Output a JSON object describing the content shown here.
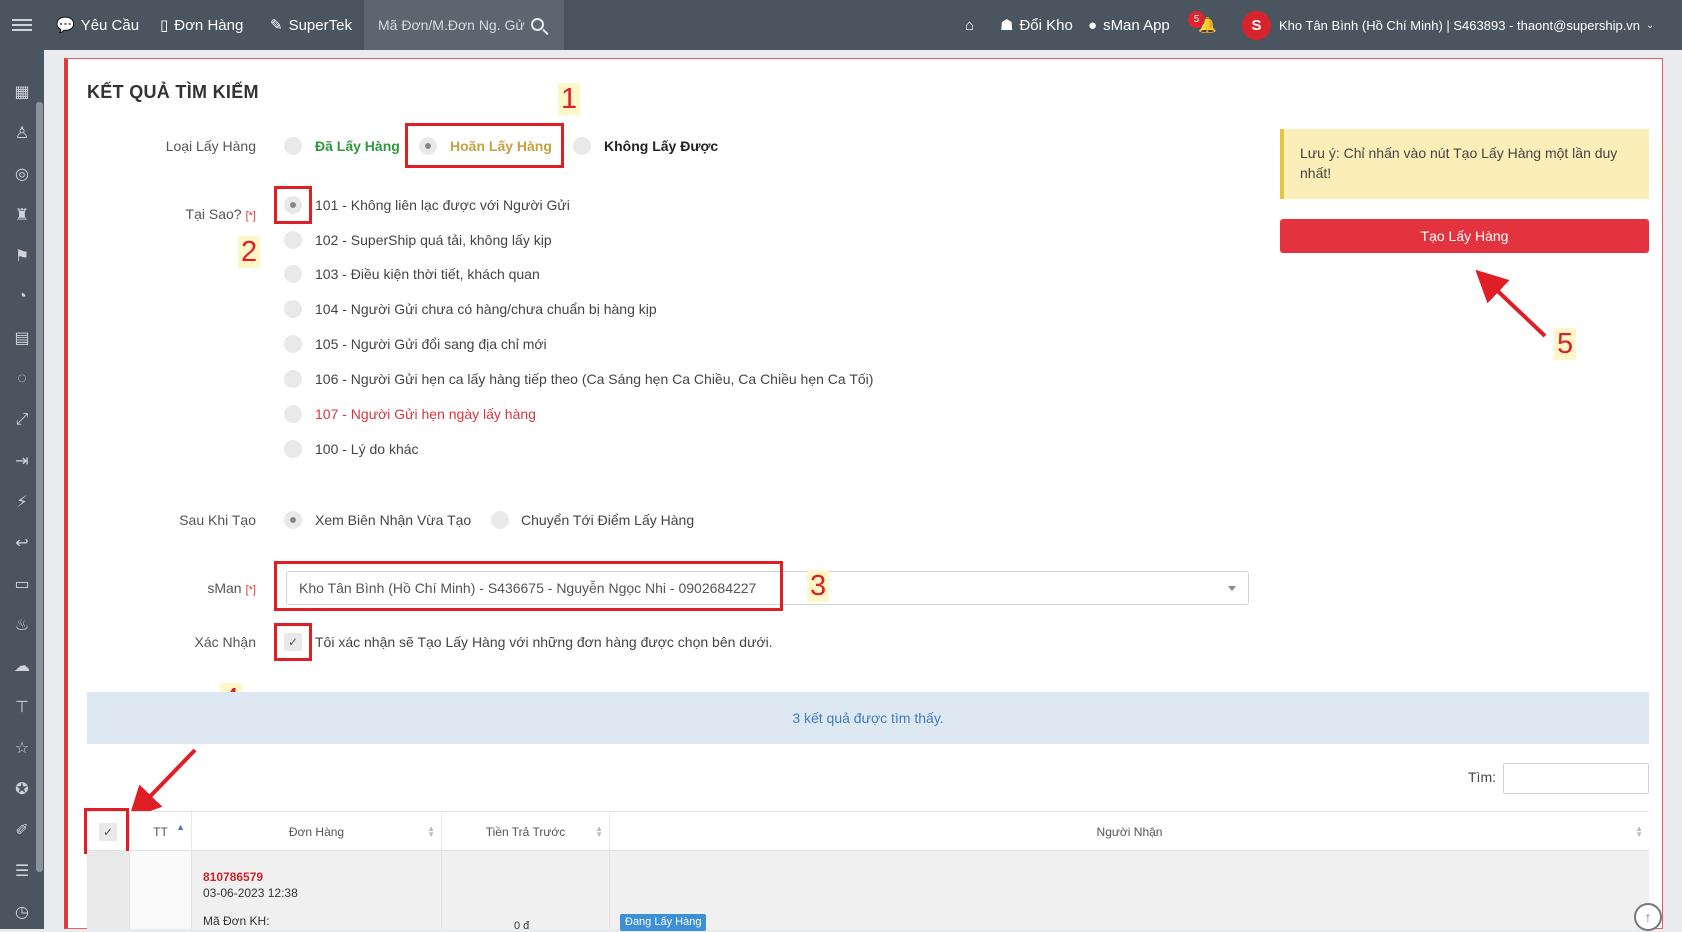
{
  "topbar": {
    "nav": [
      {
        "label": "Yêu Cầu",
        "icon": "chat-icon"
      },
      {
        "label": "Đơn Hàng",
        "icon": "document-icon"
      },
      {
        "label": "SuperTek",
        "icon": "edit-icon"
      }
    ],
    "search_placeholder": "Mã Đơn/M.Đơn Ng. Gử",
    "home_icon": "home-icon",
    "switch_warehouse": "Đổi Kho",
    "sman_app": "sMan App",
    "notification_count": "5",
    "avatar_letter": "S",
    "account": "Kho Tân Bình (Hồ Chí Minh) | S463893 - thaont@supership.vn"
  },
  "page": {
    "title": "KẾT QUẢ TÌM KIẾM",
    "pickup_type": {
      "label": "Loại Lấy Hàng",
      "options": [
        "Đã Lấy Hàng",
        "Hoãn Lấy Hàng",
        "Không Lấy Được"
      ],
      "colors": [
        "#2f9a3b",
        "#c7a041",
        "#222222"
      ]
    },
    "reason": {
      "label": "Tại Sao?",
      "required": "[*]",
      "options": [
        "101 - Không liên lạc được với Người Gửi",
        "102 - SuperShip quá tải, không lấy kịp",
        "103 - Điều kiện thời tiết, khách quan",
        "104 - Người Gửi chưa có hàng/chưa chuẩn bị hàng kịp",
        "105 - Người Gửi đổi sang địa chỉ mới",
        "106 - Người Gửi hẹn ca lấy hàng tiếp theo (Ca Sáng hẹn Ca Chiều, Ca Chiều hẹn Ca Tối)",
        "107 - Người Gửi hẹn ngày lấy hàng",
        "100 - Lý do khác"
      ]
    },
    "after_create": {
      "label": "Sau Khi Tạo",
      "options": [
        "Xem Biên Nhận Vừa Tạo",
        "Chuyển Tới Điểm Lấy Hàng"
      ]
    },
    "sman": {
      "label": "sMan",
      "required": "[*]",
      "value": "Kho Tân Bình (Hồ Chí Minh) - S436675 - Nguyễn Ngọc Nhi - 0902684227"
    },
    "confirm": {
      "label": "Xác Nhận",
      "text": "Tôi xác nhận sẽ Tạo Lấy Hàng với những đơn hàng được chọn bên dưới."
    },
    "note": "Lưu ý: Chỉ nhấn vào nút Tạo Lấy Hàng một lần duy nhất!",
    "create_button": "Tạo Lấy Hàng",
    "result_count": "3 kết quả được tìm thấy.",
    "find_label": "Tìm:"
  },
  "table": {
    "headers": [
      "TT",
      "Đơn Hàng",
      "Tiền Trả Trước",
      "Người Nhận"
    ],
    "rows": [
      {
        "code": "810786579",
        "date": "03-06-2023 12:38",
        "kh": "Mã Đơn KH:",
        "amount": "0 đ",
        "status": "Đang Lấy Hàng"
      }
    ]
  },
  "annotations": [
    "1",
    "2",
    "3",
    "4",
    "5"
  ]
}
